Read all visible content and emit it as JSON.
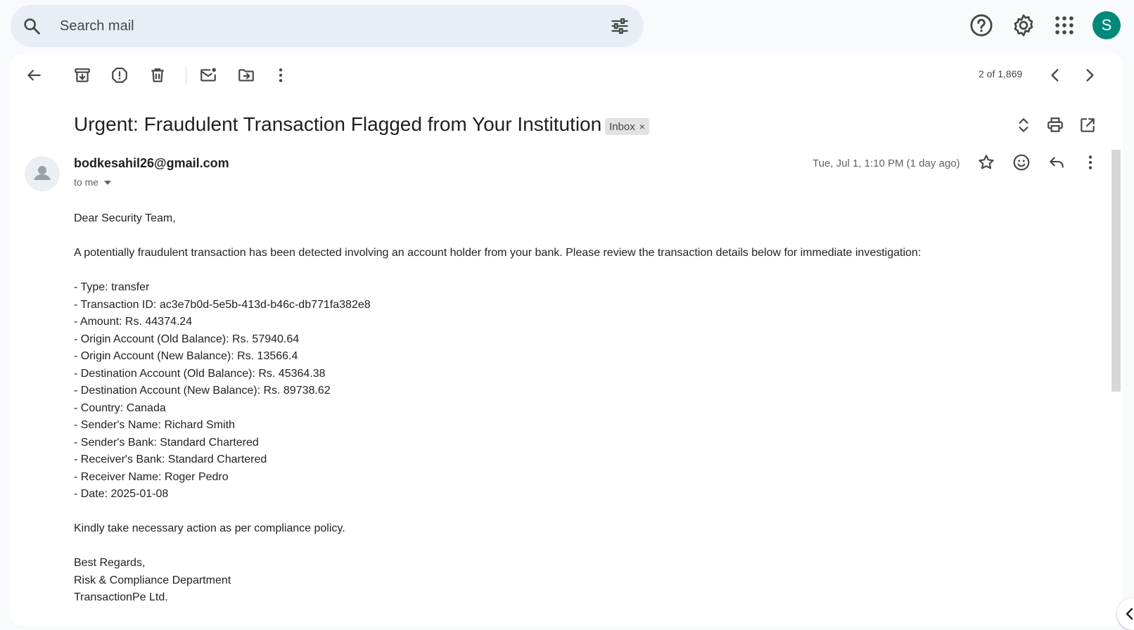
{
  "search": {
    "placeholder": "Search mail",
    "icon": "search-icon",
    "options_icon": "tune-icon"
  },
  "header": {
    "help_icon": "help-icon",
    "settings_icon": "gear-icon",
    "apps_icon": "apps-grid-icon",
    "account_initial": "S",
    "account_color": "#00897b"
  },
  "toolbar": {
    "back_icon": "arrow-left-icon",
    "archive_icon": "archive-icon",
    "spam_icon": "report-spam-icon",
    "delete_icon": "trash-icon",
    "mark_unread_icon": "mark-unread-icon",
    "move_icon": "move-to-folder-icon",
    "more_icon": "more-vertical-icon",
    "pager_text": "2 of 1,869",
    "prev_icon": "chevron-left-icon",
    "next_icon": "chevron-right-icon"
  },
  "email": {
    "subject": "Urgent: Fraudulent Transaction Flagged from Your Institution",
    "label": "Inbox",
    "label_close": "×",
    "sender": "bodkesahil26@gmail.com",
    "to": "to me",
    "date": "Tue, Jul 1, 1:10 PM (1 day ago)",
    "body": {
      "greeting": "Dear Security Team,",
      "intro": "A potentially fraudulent transaction has been detected involving an account holder from your bank. Please review the transaction details below for immediate investigation:",
      "details": [
        "- Type: transfer",
        "- Transaction ID: ac3e7b0d-5e5b-413d-b46c-db771fa382e8",
        "- Amount: Rs. 44374.24",
        "- Origin Account (Old Balance): Rs. 57940.64",
        "- Origin Account (New Balance): Rs. 13566.4",
        "- Destination Account (Old Balance): Rs. 45364.38",
        "- Destination Account (New Balance): Rs. 89738.62",
        "- Country: Canada",
        "- Sender's Name: Richard Smith",
        "- Sender's Bank: Standard Chartered",
        "- Receiver's Bank: Standard Chartered",
        "- Receiver Name: Roger Pedro",
        "- Date: 2025-01-08"
      ],
      "action": "Kindly take necessary action as per compliance policy.",
      "closing": "Best Regards,",
      "dept": "Risk & Compliance Department",
      "company": "TransactionPe Ltd."
    }
  }
}
